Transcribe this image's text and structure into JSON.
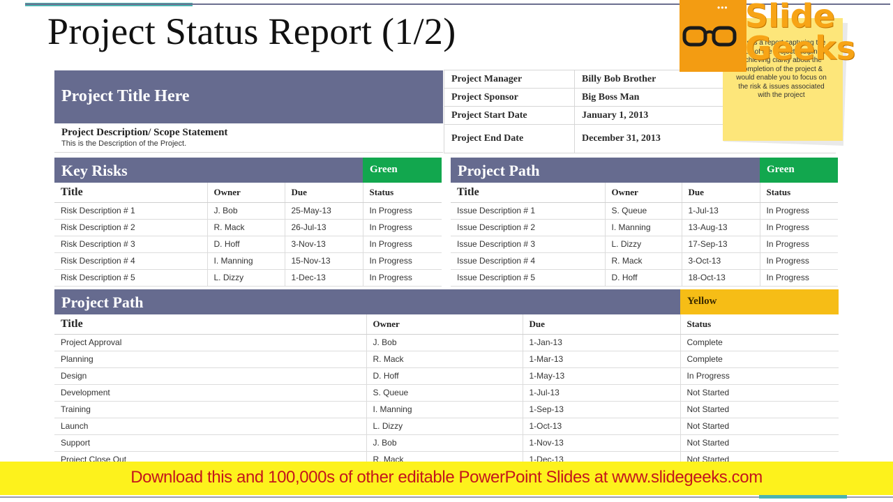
{
  "slide_title": "Project Status Report (1/2)",
  "project": {
    "title": "Project Title Here",
    "description_heading": "Project Description/ Scope Statement",
    "description_text": "This is the Description of the Project."
  },
  "info": [
    {
      "label": "Project Manager",
      "value": "Billy Bob Brother"
    },
    {
      "label": "Project Sponsor",
      "value": "Big Boss Man"
    },
    {
      "label": "Project Start Date",
      "value": "January 1, 2013"
    },
    {
      "label": "Project End Date",
      "value": "December 31, 2013"
    }
  ],
  "key_risks": {
    "title": "Key Risks",
    "status": "Green",
    "columns": [
      "Title",
      "Owner",
      "Due",
      "Status"
    ],
    "rows": [
      [
        "Risk Description # 1",
        "J. Bob",
        "25-May-13",
        "In Progress"
      ],
      [
        "Risk Description # 2",
        "R. Mack",
        "26-Jul-13",
        "In Progress"
      ],
      [
        "Risk Description # 3",
        "D. Hoff",
        "3-Nov-13",
        "In Progress"
      ],
      [
        "Risk Description # 4",
        "I. Manning",
        "15-Nov-13",
        "In Progress"
      ],
      [
        "Risk Description # 5",
        "L. Dizzy",
        "1-Dec-13",
        "In Progress"
      ]
    ]
  },
  "issues": {
    "title": "Project Path",
    "status": "Green",
    "columns": [
      "Title",
      "Owner",
      "Due",
      "Status"
    ],
    "rows": [
      [
        "Issue Description # 1",
        "S. Queue",
        "1-Jul-13",
        "In Progress"
      ],
      [
        "Issue Description # 2",
        "I. Manning",
        "13-Aug-13",
        "In Progress"
      ],
      [
        "Issue Description # 3",
        "L. Dizzy",
        "17-Sep-13",
        "In Progress"
      ],
      [
        "Issue Description # 4",
        "R. Mack",
        "3-Oct-13",
        "In Progress"
      ],
      [
        "Issue Description # 5",
        "D. Hoff",
        "18-Oct-13",
        "In Progress"
      ]
    ]
  },
  "path": {
    "title": "Project Path",
    "status": "Yellow",
    "columns": [
      "Title",
      "Owner",
      "Due",
      "Status"
    ],
    "rows": [
      [
        "Project Approval",
        "J. Bob",
        "1-Jan-13",
        "Complete"
      ],
      [
        "Planning",
        "R. Mack",
        "1-Mar-13",
        "Complete"
      ],
      [
        "Design",
        "D. Hoff",
        "1-May-13",
        "In Progress"
      ],
      [
        "Development",
        "S. Queue",
        "1-Jul-13",
        "Not Started"
      ],
      [
        "Training",
        "I. Manning",
        "1-Sep-13",
        "Not Started"
      ],
      [
        "Launch",
        "L. Dizzy",
        "1-Oct-13",
        "Not Started"
      ],
      [
        "Support",
        "J. Bob",
        "1-Nov-13",
        "Not Started"
      ],
      [
        "Project Close Out",
        "R. Mack",
        "1-Dec-13",
        "Not Started"
      ]
    ]
  },
  "note": {
    "text": "This is a report capturing the status of the project, helping in achieving clarity about the completion of the project & would enable you to focus on the risk & issues associated with the project"
  },
  "logo": {
    "text": "Slide Geeks",
    "icon": "glasses-icon"
  },
  "banner": {
    "text": "Download this and 100,000s of other editable PowerPoint Slides at www.slidegeeks.com"
  },
  "colors": {
    "header_band": "#666b8f",
    "green": "#12a74e",
    "yellow": "#f6bd16",
    "banner_bg": "#fdf21c",
    "banner_text": "#c4161c",
    "logo_orange": "#f39c12"
  }
}
